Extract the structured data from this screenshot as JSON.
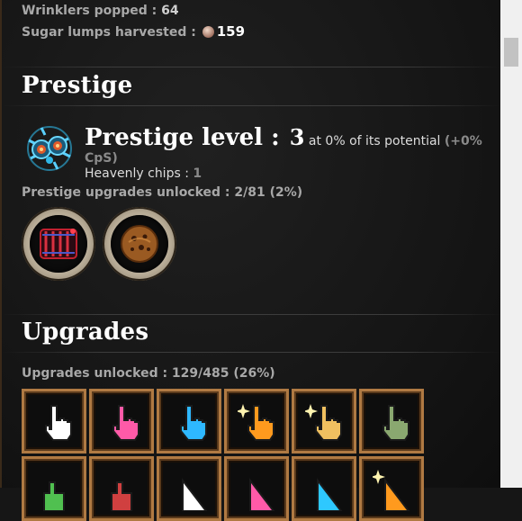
{
  "general": {
    "wrinklers_label": "Wrinklers popped : ",
    "wrinklers_value": "64",
    "lumps_label": "Sugar lumps harvested : ",
    "lumps_value": "159"
  },
  "prestige": {
    "title": "Prestige",
    "level_label": "Prestige level : ",
    "level_value": "3",
    "potential_text": " at 0% of its potential ",
    "cps_part1": "(+0%",
    "cps_part2": "CpS)",
    "chips_label": "Heavenly chips : ",
    "chips_value": "1",
    "unlocked_text": "Prestige upgrades unlocked : 2/81 (2%)",
    "upgrades": [
      "heavenly-bars-icon",
      "cookie-icon"
    ]
  },
  "upgrades": {
    "title": "Upgrades",
    "unlocked_text": "Upgrades unlocked : 129/485 (26%)",
    "row1": [
      {
        "icon": "white-cursor-icon",
        "color": "#ffffff"
      },
      {
        "icon": "pink-cursor-icon",
        "color": "#ff5aa8"
      },
      {
        "icon": "blue-cursor-icon",
        "color": "#2eb8ff"
      },
      {
        "icon": "orange-cursor-icon",
        "color": "#ff9a1e"
      },
      {
        "icon": "gold-cursor-icon",
        "color": "#f0c060"
      },
      {
        "icon": "green-cursor-icon",
        "color": "#8aa870"
      }
    ],
    "row2": [
      {
        "icon": "green-thumb-icon",
        "color": "#50c050"
      },
      {
        "icon": "red-thumb-icon",
        "color": "#d04040"
      },
      {
        "icon": "white-arrow-icon",
        "color": "#ffffff"
      },
      {
        "icon": "pink-arrow-icon",
        "color": "#ff5aa8"
      },
      {
        "icon": "cyan-arrow-icon",
        "color": "#2ec8ff"
      },
      {
        "icon": "orange-arrow-icon",
        "color": "#ff9a1e"
      }
    ]
  }
}
